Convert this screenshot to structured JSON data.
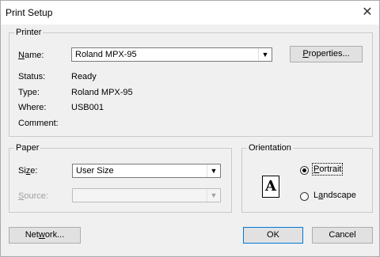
{
  "window": {
    "title": "Print Setup",
    "close_glyph": "✕"
  },
  "printer": {
    "group_label": "Printer",
    "name_label_prefix": "",
    "name_label_u": "N",
    "name_label_rest": "ame:",
    "selected_printer": "Roland MPX-95",
    "properties_u": "P",
    "properties_rest": "roperties...",
    "status_label": "Status:",
    "status_value": "Ready",
    "type_label": "Type:",
    "type_value": "Roland MPX-95",
    "where_label": "Where:",
    "where_value": "USB001",
    "comment_label": "Comment:",
    "comment_value": ""
  },
  "paper": {
    "group_label": "Paper",
    "size_label_pre": "Si",
    "size_label_u": "z",
    "size_label_rest": "e:",
    "size_value": "User Size",
    "source_label_u": "S",
    "source_label_rest": "ource:",
    "source_value": ""
  },
  "orientation": {
    "group_label": "Orientation",
    "icon_letter": "A",
    "portrait_u": "P",
    "portrait_rest": "ortrait",
    "landscape_pre": "L",
    "landscape_u": "a",
    "landscape_rest": "ndscape",
    "selected": "portrait"
  },
  "buttons": {
    "network_pre": "Net",
    "network_u": "w",
    "network_rest": "ork...",
    "ok": "OK",
    "cancel": "Cancel"
  },
  "icons": {
    "dropdown": "chevron-down-icon",
    "close": "close-icon"
  }
}
